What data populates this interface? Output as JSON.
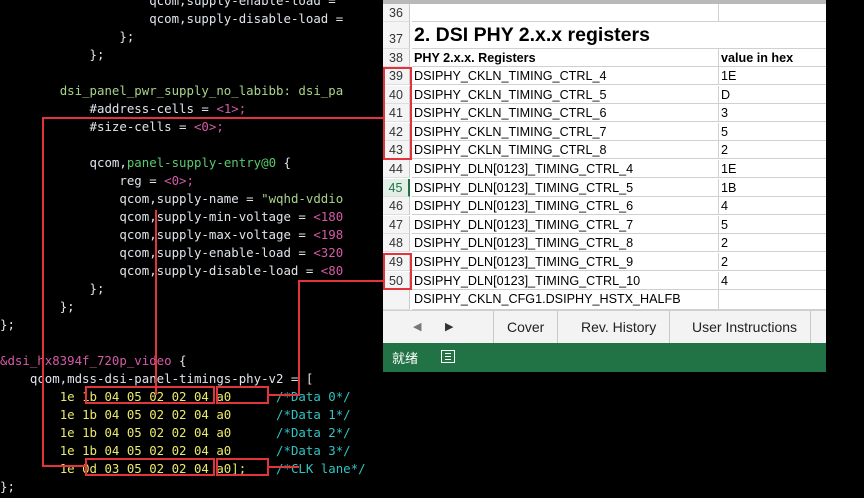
{
  "code_lines": [
    {
      "indent": "                    ",
      "parts": [
        {
          "t": "qcom,supply-enable-load = ",
          "c": "k"
        }
      ]
    },
    {
      "indent": "                    ",
      "parts": [
        {
          "t": "qcom,supply-disable-load = ",
          "c": "k"
        }
      ]
    },
    {
      "indent": "                ",
      "parts": [
        {
          "t": "};",
          "c": "brace"
        }
      ]
    },
    {
      "indent": "            ",
      "parts": [
        {
          "t": "};",
          "c": "brace"
        }
      ]
    },
    {
      "indent": "",
      "parts": [
        {
          "t": "",
          "c": "k"
        }
      ]
    },
    {
      "indent": "        ",
      "parts": [
        {
          "t": "dsi_panel_pwr_supply_no_labibb: ",
          "c": "g"
        },
        {
          "t": "dsi_pa",
          "c": "g"
        }
      ]
    },
    {
      "indent": "            ",
      "parts": [
        {
          "t": "#address-cells = ",
          "c": "k"
        },
        {
          "t": "<1>;",
          "c": "pk"
        }
      ]
    },
    {
      "indent": "            ",
      "parts": [
        {
          "t": "#size-cells = ",
          "c": "k"
        },
        {
          "t": "<0>;",
          "c": "pk"
        }
      ]
    },
    {
      "indent": "",
      "parts": [
        {
          "t": "",
          "c": "k"
        }
      ]
    },
    {
      "indent": "            ",
      "parts": [
        {
          "t": "qcom,",
          "c": "k"
        },
        {
          "t": "panel-supply-entry@0",
          "c": "gr"
        },
        {
          "t": " {",
          "c": "k"
        }
      ]
    },
    {
      "indent": "                ",
      "parts": [
        {
          "t": "reg = ",
          "c": "k"
        },
        {
          "t": "<0>;",
          "c": "pk"
        }
      ]
    },
    {
      "indent": "                ",
      "parts": [
        {
          "t": "qcom,supply-name = ",
          "c": "k"
        },
        {
          "t": "\"wqhd-vddio",
          "c": "g"
        }
      ]
    },
    {
      "indent": "                ",
      "parts": [
        {
          "t": "qcom,supply-min-voltage = ",
          "c": "k"
        },
        {
          "t": "<180",
          "c": "pk"
        }
      ]
    },
    {
      "indent": "                ",
      "parts": [
        {
          "t": "qcom,supply-max-voltage = ",
          "c": "k"
        },
        {
          "t": "<198",
          "c": "pk"
        }
      ]
    },
    {
      "indent": "                ",
      "parts": [
        {
          "t": "qcom,supply-enable-load = ",
          "c": "k"
        },
        {
          "t": "<320",
          "c": "pk"
        }
      ]
    },
    {
      "indent": "                ",
      "parts": [
        {
          "t": "qcom,supply-disable-load = ",
          "c": "k"
        },
        {
          "t": "<80",
          "c": "pk"
        }
      ]
    },
    {
      "indent": "            ",
      "parts": [
        {
          "t": "};",
          "c": "brace"
        }
      ]
    },
    {
      "indent": "        ",
      "parts": [
        {
          "t": "};",
          "c": "brace"
        }
      ]
    },
    {
      "indent": "",
      "parts": [
        {
          "t": "};",
          "c": "brace"
        }
      ]
    },
    {
      "indent": "",
      "parts": [
        {
          "t": "",
          "c": "k"
        }
      ]
    },
    {
      "indent": "",
      "parts": [
        {
          "t": "&dsi_hx8394f_720p_video",
          "c": "pk"
        },
        {
          "t": " {",
          "c": "k"
        }
      ]
    },
    {
      "indent": "    ",
      "parts": [
        {
          "t": "qcom,mdss-dsi-panel-timings-phy-v2 = [",
          "c": "k"
        }
      ]
    },
    {
      "indent": "        ",
      "parts": [
        {
          "t": "1e 1b 04 05 02 02 04 a0",
          "c": "hx"
        },
        {
          "t": "      /*Data 0*/",
          "c": "cm"
        }
      ]
    },
    {
      "indent": "        ",
      "parts": [
        {
          "t": "1e 1b 04 05 02 02 04 a0",
          "c": "hx"
        },
        {
          "t": "      /*Data 1*/",
          "c": "cm"
        }
      ]
    },
    {
      "indent": "        ",
      "parts": [
        {
          "t": "1e 1b 04 05 02 02 04 a0",
          "c": "hx"
        },
        {
          "t": "      /*Data 2*/",
          "c": "cm"
        }
      ]
    },
    {
      "indent": "        ",
      "parts": [
        {
          "t": "1e 1b 04 05 02 02 04 a0",
          "c": "hx"
        },
        {
          "t": "      /*Data 3*/",
          "c": "cm"
        }
      ]
    },
    {
      "indent": "        ",
      "parts": [
        {
          "t": "1e 0d 03 05 02 02 04 a0];",
          "c": "hx"
        },
        {
          "t": "    /*CLK lane*/",
          "c": "cm"
        }
      ]
    },
    {
      "indent": "",
      "parts": [
        {
          "t": "};",
          "c": "brace"
        }
      ]
    }
  ],
  "sheet": {
    "row36": "36",
    "title_row": "37",
    "title": "2. DSI PHY 2.x.x registers",
    "header_row": "38",
    "header_a": "PHY 2.x.x. Registers",
    "header_b": "value in hex",
    "rows": [
      {
        "num": "39",
        "name": "DSIPHY_CKLN_TIMING_CTRL_4",
        "val": "1E"
      },
      {
        "num": "40",
        "name": "DSIPHY_CKLN_TIMING_CTRL_5",
        "val": "D"
      },
      {
        "num": "41",
        "name": "DSIPHY_CKLN_TIMING_CTRL_6",
        "val": "3"
      },
      {
        "num": "42",
        "name": "DSIPHY_CKLN_TIMING_CTRL_7",
        "val": "5"
      },
      {
        "num": "43",
        "name": "DSIPHY_CKLN_TIMING_CTRL_8",
        "val": "2"
      },
      {
        "num": "44",
        "name": "DSIPHY_DLN[0123]_TIMING_CTRL_4",
        "val": "1E"
      },
      {
        "num": "45",
        "name": "DSIPHY_DLN[0123]_TIMING_CTRL_5",
        "val": "1B"
      },
      {
        "num": "46",
        "name": "DSIPHY_DLN[0123]_TIMING_CTRL_6",
        "val": "4"
      },
      {
        "num": "47",
        "name": "DSIPHY_DLN[0123]_TIMING_CTRL_7",
        "val": "5"
      },
      {
        "num": "48",
        "name": "DSIPHY_DLN[0123]_TIMING_CTRL_8",
        "val": "2"
      },
      {
        "num": "49",
        "name": "DSIPHY_DLN[0123]_TIMING_CTRL_9",
        "val": "2"
      },
      {
        "num": "50",
        "name": "DSIPHY_DLN[0123]_TIMING_CTRL_10",
        "val": "4"
      }
    ],
    "row51_name": "DSIPHY_CKLN_CFG1.DSIPHY_HSTX_HALFB",
    "tabs": [
      "Cover",
      "Rev. History",
      "User Instructions"
    ],
    "status_ready": "就绪"
  }
}
